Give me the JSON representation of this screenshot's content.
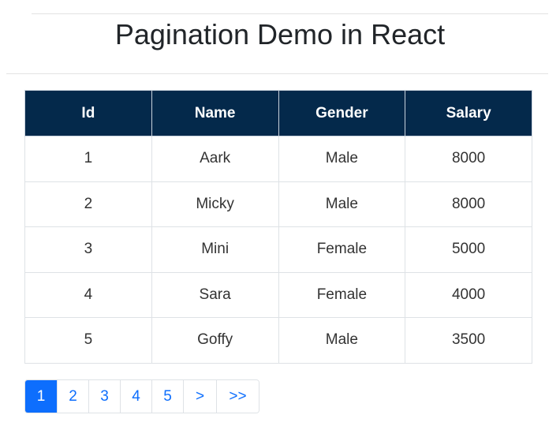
{
  "header": {
    "title": "Pagination Demo in React"
  },
  "table": {
    "columns": [
      "Id",
      "Name",
      "Gender",
      "Salary"
    ],
    "rows": [
      [
        "1",
        "Aark",
        "Male",
        "8000"
      ],
      [
        "2",
        "Micky",
        "Male",
        "8000"
      ],
      [
        "3",
        "Mini",
        "Female",
        "5000"
      ],
      [
        "4",
        "Sara",
        "Female",
        "4000"
      ],
      [
        "5",
        "Goffy",
        "Male",
        "3500"
      ]
    ]
  },
  "pagination": {
    "items": [
      "1",
      "2",
      "3",
      "4",
      "5",
      ">",
      ">>"
    ],
    "active_page": "1"
  },
  "colors": {
    "header_bg": "#04294b",
    "active_page_bg": "#0d6efd",
    "link_color": "#0d6efd"
  }
}
